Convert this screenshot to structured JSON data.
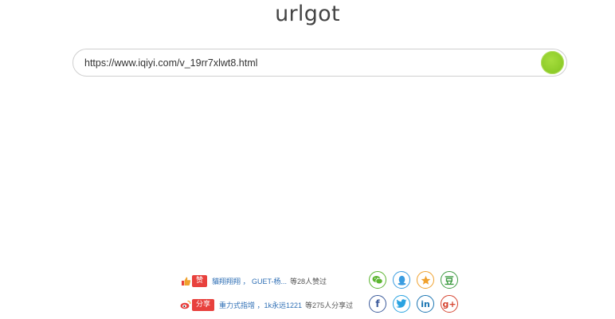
{
  "app": {
    "title": "urlgot"
  },
  "search": {
    "value": "https://www.iqiyi.com/v_19rr7xlwt8.html"
  },
  "footer": {
    "like": {
      "pill": "赞",
      "names": "貓翔翔翔 ， GUET-杨...",
      "count": "等28人赞过"
    },
    "share": {
      "pill": "分享",
      "names": "重力式指增 ，1k永远1221",
      "count": "等275人分享过"
    },
    "social_icons": [
      "wechat-icon",
      "qq-icon",
      "qzone-star-icon",
      "douban-icon",
      "facebook-icon",
      "twitter-icon",
      "linkedin-icon",
      "google-plus-icon"
    ],
    "social_glyphs": {
      "douban": "豆",
      "facebook": "f",
      "linkedin": "in",
      "google": "g+"
    },
    "colors": {
      "wechat": "#5cb531",
      "qq": "#3a9ce0",
      "qzone": "#f0a12d",
      "douban": "#3f9c43",
      "facebook": "#3b5a9b",
      "twitter": "#2aa3e1",
      "linkedin": "#1b75b2",
      "google": "#d5432f",
      "go_button": "#8fcd2a",
      "pill": "#e8413d"
    }
  }
}
